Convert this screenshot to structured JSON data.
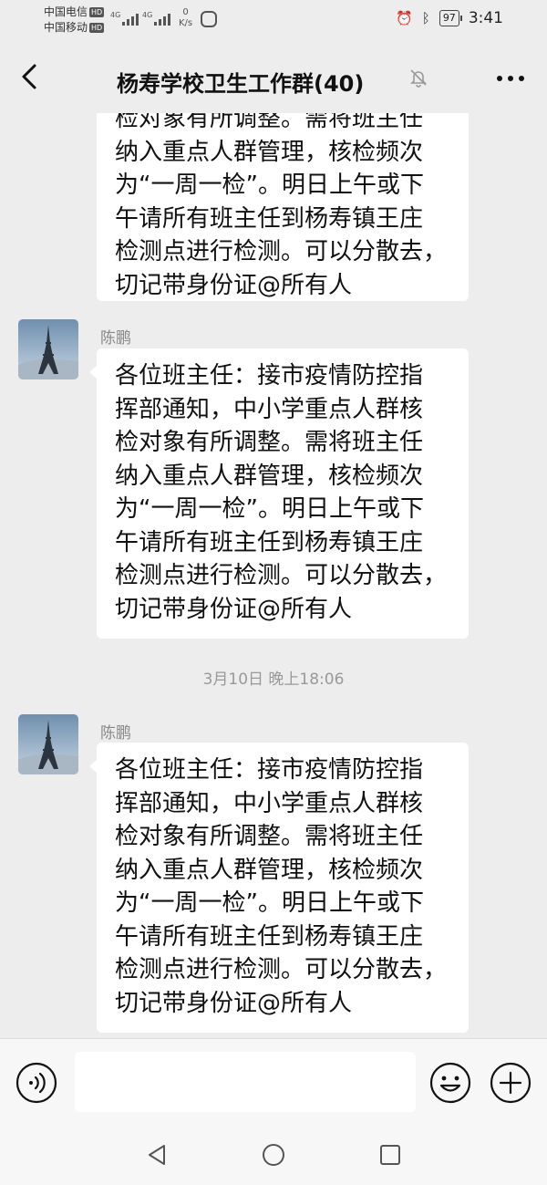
{
  "status_bar": {
    "carrier1": "中国电信",
    "carrier2": "中国移动",
    "hd": "HD",
    "signal_type": "4G",
    "speed_value": "0",
    "speed_unit": "K/s",
    "battery": "97",
    "time": "3:41"
  },
  "header": {
    "title": "杨寿学校卫生工作群(40)"
  },
  "messages": [
    {
      "text": "检对象有所调整。需将班主任\n纳入重点人群管理，核检频次\n为“一周一检”。明日上午或下\n午请所有班主任到杨寿镇王庄\n检测点进行检测。可以分散去，\n切记带身份证@所有人"
    },
    {
      "sender": "陈鹏",
      "text": "各位班主任：接市疫情防控指\n挥部通知，中小学重点人群核\n检对象有所调整。需将班主任\n纳入重点人群管理，核检频次\n为“一周一检”。明日上午或下\n午请所有班主任到杨寿镇王庄\n检测点进行检测。可以分散去，\n切记带身份证@所有人"
    },
    {
      "timestamp": "3月10日 晚上18:06"
    },
    {
      "sender": "陈鹏",
      "text": "各位班主任：接市疫情防控指\n挥部通知，中小学重点人群核\n检对象有所调整。需将班主任\n纳入重点人群管理，核检频次\n为“一周一检”。明日上午或下\n午请所有班主任到杨寿镇王庄\n检测点进行检测。可以分散去，\n切记带身份证@所有人"
    }
  ],
  "input": {
    "value": "",
    "placeholder": ""
  }
}
